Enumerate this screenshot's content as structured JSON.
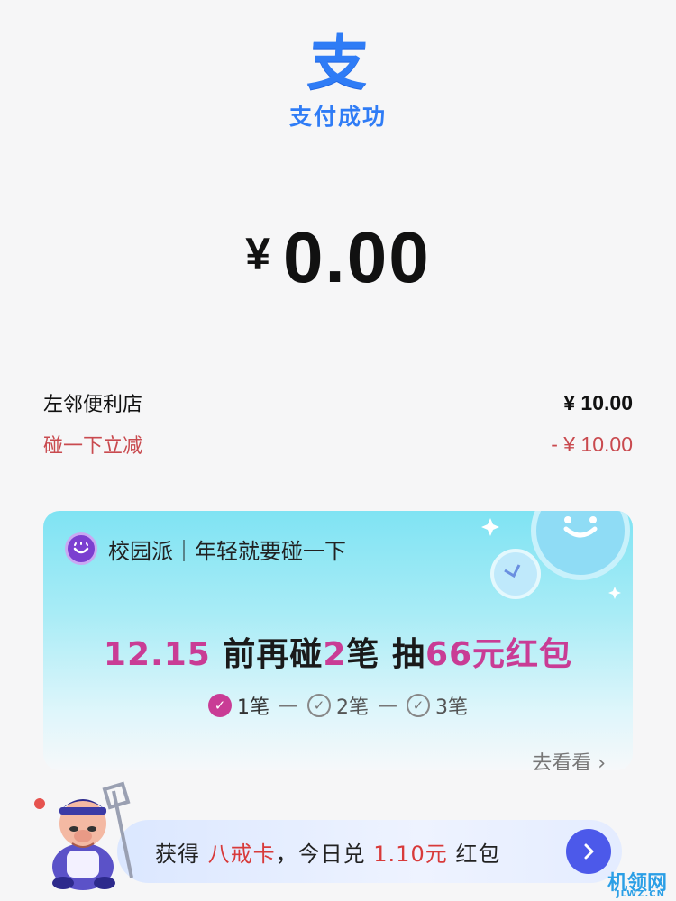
{
  "header": {
    "logo_glyph": "支",
    "status_text": "支付成功",
    "accent_color": "#2f7cf6"
  },
  "payment": {
    "currency": "¥",
    "amount": "0.00"
  },
  "details": {
    "merchant_label": "左邻便利店",
    "merchant_amount": "¥ 10.00",
    "discount_label": "碰一下立减",
    "discount_amount": "- ¥ 10.00",
    "discount_color": "#c94a4f"
  },
  "promo_card": {
    "title": "校园派｜年轻就要碰一下",
    "headline": {
      "p1": "12.15",
      "p2": " 前再碰",
      "p3": "2",
      "p4": "笔 抽",
      "p5": "66元红包"
    },
    "accent_color": "#c93c95",
    "steps": [
      {
        "label": "1笔",
        "done": true
      },
      {
        "label": "2笔",
        "done": false
      },
      {
        "label": "3笔",
        "done": false
      }
    ],
    "step_separator": "—",
    "link_text": "去看看 ›"
  },
  "banner": {
    "t1": "获得 ",
    "t2": "八戒卡",
    "t3": "，今日兑 ",
    "t4": "1.10元",
    "t5": " 红包"
  },
  "icons": {
    "logo": "alipay-logo-icon",
    "badge": "smile-badge-icon",
    "sticker": "surprise-sticker-icon",
    "check": "check-icon",
    "arrow": "chevron-right-icon",
    "mascot": "mascot-character-icon"
  },
  "watermark": {
    "text": "机领网",
    "sub": "JLWZ.CN"
  }
}
